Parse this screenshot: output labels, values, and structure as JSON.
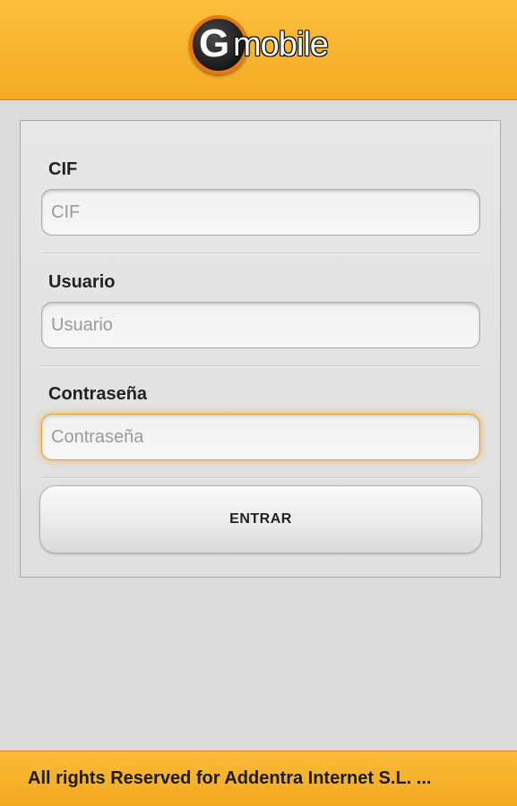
{
  "header": {
    "logo": {
      "letter": "G",
      "text": "mobile",
      "colors": {
        "ring": "#e6781a",
        "circle": "#1c1c1c",
        "text": "#ffffff"
      }
    },
    "background_color": "#f7b22c"
  },
  "form": {
    "fields": [
      {
        "label": "CIF",
        "placeholder": "CIF",
        "value": "",
        "focused": false
      },
      {
        "label": "Usuario",
        "placeholder": "Usuario",
        "value": "",
        "focused": false
      },
      {
        "label": "Contraseña",
        "placeholder": "Contraseña",
        "value": "",
        "focused": true
      }
    ],
    "submit_label": "ENTRAR"
  },
  "footer": {
    "text": "All rights Reserved for Addentra Internet S.L. ..."
  }
}
